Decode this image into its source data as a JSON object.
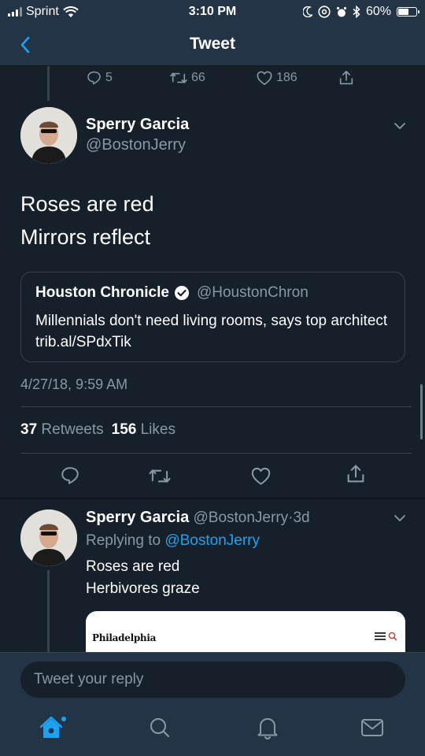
{
  "status_bar": {
    "carrier": "Sprint",
    "time": "3:10 PM",
    "battery_percent": "60%",
    "battery_level": 0.6,
    "icons": [
      "signal-icon",
      "wifi-icon",
      "moon-icon",
      "at-sign-icon",
      "alarm-icon",
      "bluetooth-icon",
      "battery-icon"
    ]
  },
  "nav": {
    "title": "Tweet",
    "back_icon": "chevron-left-icon"
  },
  "prev_tweet_actions": {
    "replies": "5",
    "retweets": "66",
    "likes": "186"
  },
  "main_tweet": {
    "author_name": "Sperry Garcia",
    "author_handle": "@BostonJerry",
    "lines": [
      "Roses are red",
      "Mirrors reflect"
    ],
    "quote": {
      "name": "Houston Chronicle",
      "handle": "@HoustonChron",
      "text": "Millennials don't need living rooms, says top architect trib.al/SPdxTik"
    },
    "timestamp": "4/27/18, 9:59 AM",
    "retweets_count": "37",
    "retweets_label": "Retweets",
    "likes_count": "156",
    "likes_label": "Likes"
  },
  "reply_tweet": {
    "author_name": "Sperry Garcia",
    "author_handle": "@BostonJerry",
    "separator": "·",
    "age": "3d",
    "replying_label": "Replying to",
    "replying_handle": "@BostonJerry",
    "lines": [
      "Roses are red",
      "Herbivores graze"
    ],
    "card_title": "Philadelphia"
  },
  "reply_bar": {
    "placeholder": "Tweet your reply"
  },
  "tabs": [
    {
      "name": "home",
      "icon": "home-icon",
      "active": true
    },
    {
      "name": "search",
      "icon": "search-icon",
      "active": false
    },
    {
      "name": "notifications",
      "icon": "bell-icon",
      "active": false
    },
    {
      "name": "messages",
      "icon": "mail-icon",
      "active": false
    }
  ],
  "colors": {
    "background": "#15202b",
    "bar": "#243447",
    "accent": "#1da1f2",
    "secondary_text": "#8899a6",
    "border": "#38444d"
  }
}
